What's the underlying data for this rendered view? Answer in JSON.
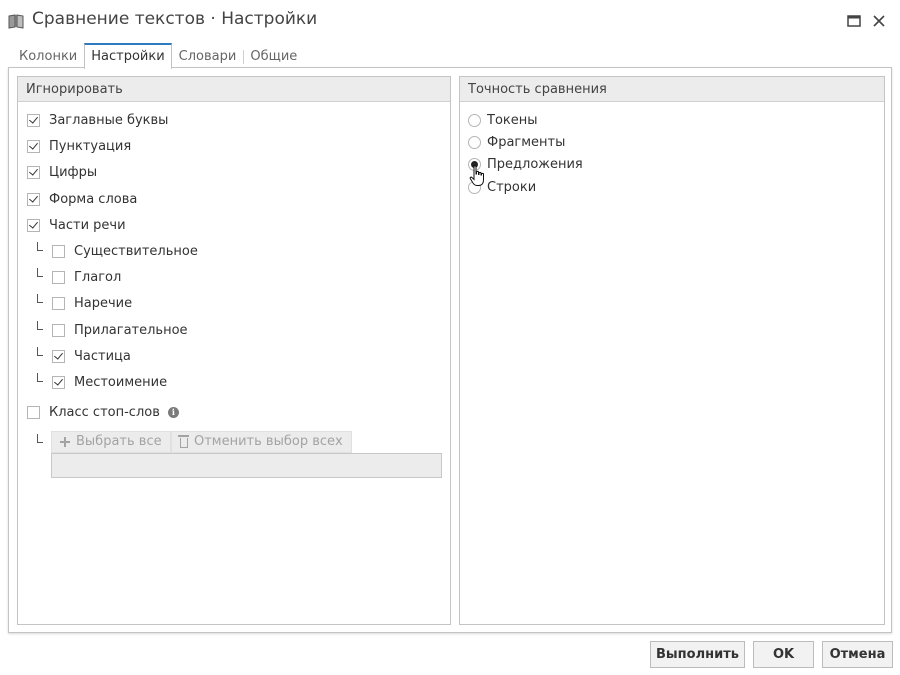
{
  "window": {
    "title": "Сравнение текстов · Настройки",
    "app_icon": "book-icon",
    "controls": [
      "maximize-icon",
      "close-icon"
    ]
  },
  "tabs": [
    {
      "label": "Колонки",
      "active": false
    },
    {
      "label": "Настройки",
      "active": true
    },
    {
      "label": "Словари",
      "active": false
    },
    {
      "label": "Общие",
      "active": false
    }
  ],
  "ignore_panel": {
    "title": "Игнорировать",
    "items": [
      {
        "label": "Заглавные буквы",
        "checked": true
      },
      {
        "label": "Пунктуация",
        "checked": true
      },
      {
        "label": "Цифры",
        "checked": true
      },
      {
        "label": "Форма слова",
        "checked": true
      },
      {
        "label": "Части речи",
        "checked": true
      }
    ],
    "parts_of_speech": [
      {
        "label": "Существительное",
        "checked": false
      },
      {
        "label": "Глагол",
        "checked": false
      },
      {
        "label": "Наречие",
        "checked": false
      },
      {
        "label": "Прилагательное",
        "checked": false
      },
      {
        "label": "Частица",
        "checked": true
      },
      {
        "label": "Местоимение",
        "checked": true
      }
    ],
    "stopwords": {
      "label": "Класс стоп-слов",
      "checked": false,
      "info_icon": "info-icon",
      "select_all_label": "Выбрать все",
      "deselect_all_label": "Отменить выбор всех",
      "value": ""
    }
  },
  "accuracy_panel": {
    "title": "Точность сравнения",
    "options": [
      {
        "label": "Токены",
        "selected": false
      },
      {
        "label": "Фрагменты",
        "selected": false
      },
      {
        "label": "Предложения",
        "selected": true
      },
      {
        "label": "Строки",
        "selected": false
      }
    ]
  },
  "footer": {
    "run_label": "Выполнить",
    "ok_label": "OK",
    "cancel_label": "Отмена"
  },
  "colors": {
    "accent": "#2f7bbf",
    "header_bg": "#ececec",
    "border": "#c4c4c4"
  }
}
